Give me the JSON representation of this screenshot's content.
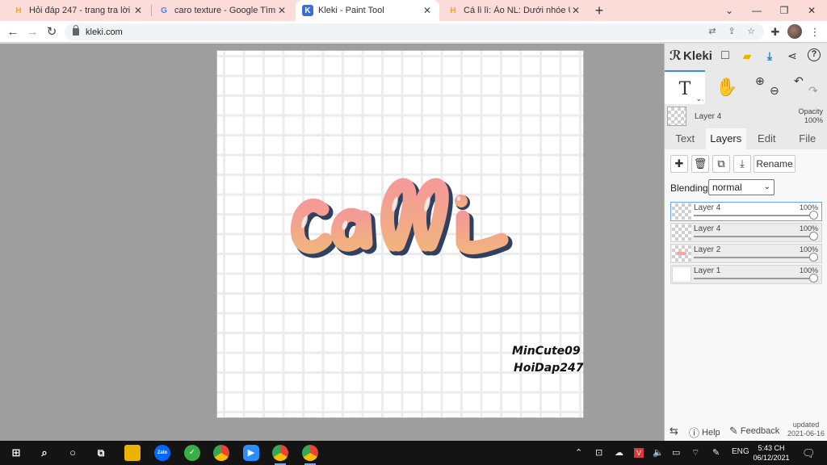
{
  "browser": {
    "tabs": [
      {
        "title": "Hỏi đáp 247 - trang tra lời",
        "favicon": "H",
        "favicon_color": "#f2a623",
        "active": false
      },
      {
        "title": "caro texture - Google Tìm kiếm",
        "favicon": "G",
        "favicon_color": "#4285f4",
        "active": false
      },
      {
        "title": "Kleki - Paint Tool",
        "favicon": "K",
        "favicon_color": "#3b6fd8",
        "active": true
      },
      {
        "title": "Cá lì lì: Ảo NL: Dưới nhóe UwU Cá",
        "favicon": "H",
        "favicon_color": "#f2a623",
        "active": false
      }
    ],
    "new_tab": "+",
    "url": "kleki.com"
  },
  "canvas": {
    "artwork_text": "calli",
    "signature": [
      "MinCute09",
      "HoiDap247"
    ]
  },
  "kleki": {
    "brand": "Kleki",
    "current_layer": {
      "name": "Layer 4",
      "opacity_label": "Opacity",
      "opacity_value": "100%"
    },
    "panel_tabs": [
      "Text",
      "Layers",
      "Edit",
      "File"
    ],
    "active_tab": "Layers",
    "rename_label": "Rename",
    "blending_label": "Blending",
    "blending_value": "normal",
    "layers": [
      {
        "name": "Layer 4",
        "opacity": "100%",
        "selected": true
      },
      {
        "name": "Layer 4",
        "opacity": "100%",
        "selected": false
      },
      {
        "name": "Layer 2",
        "opacity": "100%",
        "selected": false
      },
      {
        "name": "Layer 1",
        "opacity": "100%",
        "selected": false
      }
    ],
    "footer": {
      "help": "Help",
      "feedback": "Feedback",
      "updated_label": "updated",
      "updated_date": "2021-06-16"
    }
  },
  "taskbar": {
    "language": "ENG",
    "time": "5:43 CH",
    "date": "06/12/2021",
    "zalo_label": "Zalo"
  },
  "colors": {
    "accent": "#3b8ce4",
    "tab_strip": "#fbdcd9",
    "artwork_gradient_top": "#f4a39a",
    "artwork_gradient_bottom": "#f0b07f",
    "artwork_outline": "#2f4061"
  }
}
